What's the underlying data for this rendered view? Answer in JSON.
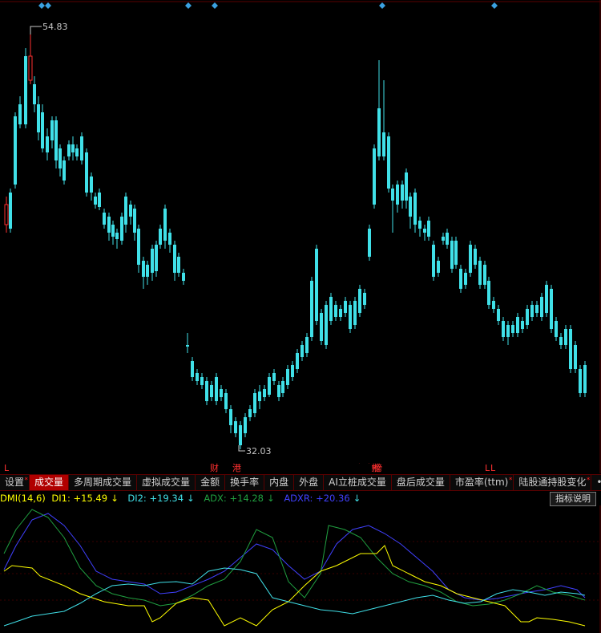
{
  "main_chart": {
    "type": "candlestick",
    "high_label": "54.83",
    "low_label": "32.03",
    "markers": [
      {
        "text": "L",
        "color": "#ff3030"
      },
      {
        "text": "财",
        "color": "#ff3030"
      },
      {
        "text": "港",
        "color": "#ff3030"
      },
      {
        "text": "龙虎榜",
        "color": "#ff3030"
      },
      {
        "text": "L",
        "color": "#ff3030"
      },
      {
        "text": "L",
        "color": "#ff3030"
      }
    ],
    "colors": {
      "up": "#ff3030",
      "down": "#40e0e8"
    }
  },
  "tabs": [
    {
      "label": "设置",
      "dot": true
    },
    {
      "label": "成交量",
      "active": true
    },
    {
      "label": "多周期成交量"
    },
    {
      "label": "虚拟成交量"
    },
    {
      "label": "金额"
    },
    {
      "label": "换手率"
    },
    {
      "label": "内盘"
    },
    {
      "label": "外盘"
    },
    {
      "label": "AI立桩成交量"
    },
    {
      "label": "盘后成交量"
    },
    {
      "label": "市盈率(ttm)",
      "dot": true
    },
    {
      "label": "陆股通持股变化",
      "dot": true
    },
    {
      "label": "•••"
    }
  ],
  "indicator": {
    "name": "DMI(14,6)",
    "di1_label": "DI1: +15.49",
    "di2_label": "DI2: +19.34",
    "adx_label": "ADX: +14.28",
    "adxr_label": "ADXR: +20.36",
    "arrow": "↓",
    "explain_button": "指标说明",
    "colors": {
      "name": "#ffff00",
      "di1": "#ffff00",
      "di2": "#40e0e8",
      "adx": "#20a040",
      "adxr": "#4040ff"
    }
  }
}
